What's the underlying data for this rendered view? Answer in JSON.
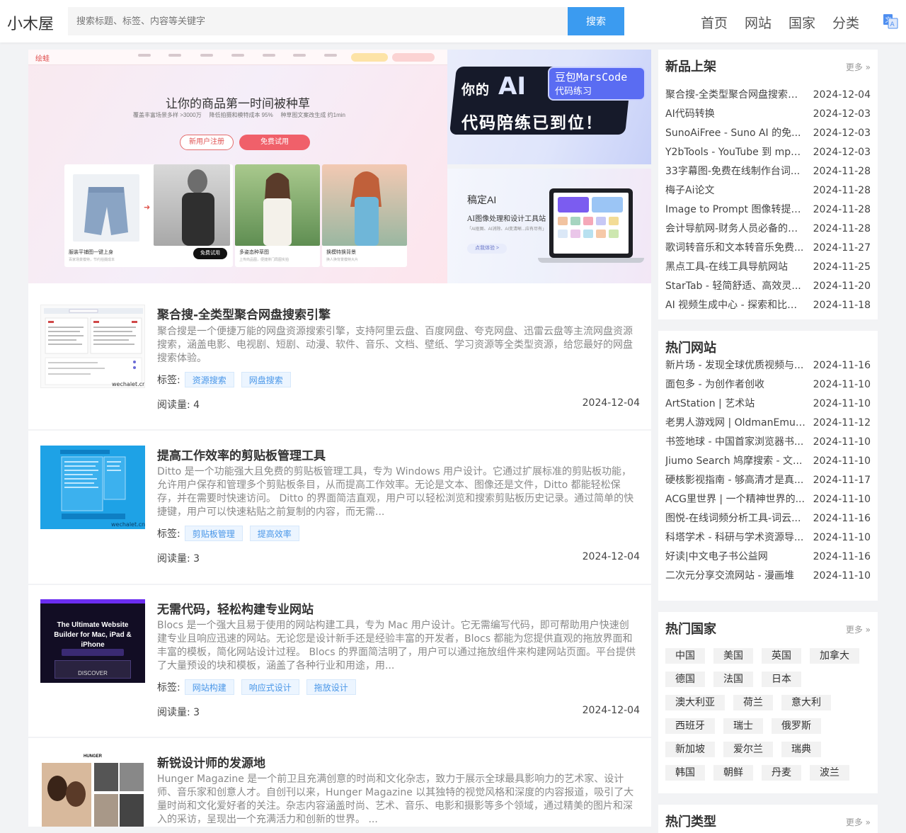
{
  "header": {
    "logo": "小木屋",
    "search_placeholder": "搜索标题、标签、内容等关键字",
    "search_button": "搜索",
    "nav": [
      "首页",
      "网站",
      "国家",
      "分类"
    ],
    "lang_icon": "translate-icon"
  },
  "banner": {
    "main": {
      "brand": "绘蛙",
      "title": "让你的商品第一时间被种草",
      "stats": [
        "覆盖丰富场景多样 >3000万",
        "降低拍摄和模特成本 95%",
        "种草图文案改生成 约1min"
      ],
      "register_button": "新用户注册",
      "trial_button": "免费试用",
      "panel1_label": "服装平铺图一键上身",
      "panel1_sub": "百家场景模特，节约拍摄成本",
      "panel1_button": "免费试用",
      "panel2_label": "多姿态种草图",
      "panel2_sub": "上传商品图，便捷排门局图实拍",
      "panel3_label": "换模特换背景",
      "panel3_sub": "换人换背景模特大片"
    },
    "side1": {
      "line1": "你的",
      "ai": "AI",
      "line2": "代码陪练已到位！",
      "blue1": "豆包MarsCode",
      "blue2": "代码练习"
    },
    "side2": {
      "title": "稿定AI",
      "subtitle": "AI图像处理和设计工具站",
      "small": "「AI抠图、AI消除、AI变清晰...应有尽有」",
      "button": "点我体验 >"
    }
  },
  "articles": [
    {
      "title": "聚合搜-全类型聚合网盘搜索引擎",
      "desc": "聚合搜是一个便捷万能的网盘资源搜索引擎，支持阿里云盘、百度网盘、夸克网盘、迅雷云盘等主流网盘资源搜索，涵盖电影、电视剧、短剧、动漫、软件、音乐、文档、壁纸、学习资源等全类型资源，给您最好的网盘搜索体验。",
      "tag_label": "标签:",
      "tags": [
        "资源搜索",
        "网盘搜索"
      ],
      "reads": "阅读量: 4",
      "date": "2024-12-04",
      "thumb_watermark": "wechalet.cn"
    },
    {
      "title": "提高工作效率的剪贴板管理工具",
      "desc": "Ditto 是一个功能强大且免费的剪贴板管理工具，专为 Windows 用户设计。它通过扩展标准的剪贴板功能，允许用户保存和管理多个剪贴板条目，从而提高工作效率。无论是文本、图像还是文件，Ditto 都能轻松保存，并在需要时快速访问。 Ditto 的界面简洁直观，用户可以轻松浏览和搜索剪贴板历史记录。通过简单的快捷键，用户可以快速粘贴之前复制的内容，而无需...",
      "tag_label": "标签:",
      "tags": [
        "剪贴板管理",
        "提高效率"
      ],
      "reads": "阅读量: 3",
      "date": "2024-12-04",
      "thumb_watermark": "wechalet.cn"
    },
    {
      "title": "无需代码，轻松构建专业网站",
      "desc": "Blocs 是一个强大且易于使用的网站构建工具，专为 Mac 用户设计。它无需编写代码，即可帮助用户快速创建专业且响应迅速的网站。无论您是设计新手还是经验丰富的开发者，Blocs 都能为您提供直观的拖放界面和丰富的模板，简化网站设计过程。 Blocs 的界面简洁明了，用户可以通过拖放组件来构建网站页面。平台提供了大量预设的块和模板，涵盖了各种行业和用途，用...",
      "tag_label": "标签:",
      "tags": [
        "网站构建",
        "响应式设计",
        "拖放设计"
      ],
      "reads": "阅读量: 3",
      "date": "2024-12-04",
      "thumb_title": "The Ultimate Website Builder for Mac, iPad & iPhone",
      "thumb_button": "DISCOVER"
    },
    {
      "title": "新锐设计师的发源地",
      "desc": "Hunger Magazine 是一个前卫且充满创意的时尚和文化杂志，致力于展示全球最具影响力的艺术家、设计师、音乐家和创意人才。自创刊以来，Hunger Magazine 以其独特的视觉风格和深度的内容报道，吸引了大量时尚和文化爱好者的关注。杂志内容涵盖时尚、艺术、音乐、电影和摄影等多个领域，通过精美的图片和深入的采访，呈现出一个充满活力和创新的世界。 ...",
      "thumb_title": "HUNGER"
    }
  ],
  "sidebar": {
    "new": {
      "title": "新品上架",
      "more": "更多 »",
      "items": [
        {
          "name": "聚合搜-全类型聚合网盘搜索引...",
          "date": "2024-12-04"
        },
        {
          "name": "AI代码转换",
          "date": "2024-12-03"
        },
        {
          "name": "SunoAiFree - Suno AI 的免...",
          "date": "2024-12-03"
        },
        {
          "name": "Y2bTools - YouTube 到 mp3...",
          "date": "2024-12-03"
        },
        {
          "name": "33字幕图-免费在线制作台词...",
          "date": "2024-11-28"
        },
        {
          "name": "梅子Ai论文",
          "date": "2024-11-28"
        },
        {
          "name": "Image to Prompt 图像转提示...",
          "date": "2024-11-28"
        },
        {
          "name": "会计导航网-财务人员必备的会...",
          "date": "2024-11-28"
        },
        {
          "name": "歌词转音乐和文本转音乐免费...",
          "date": "2024-11-27"
        },
        {
          "name": "黑点工具-在线工具导航网站",
          "date": "2024-11-25"
        },
        {
          "name": "StarTab - 轻简舒适、高效灵...",
          "date": "2024-11-20"
        },
        {
          "name": "AI 视频生成中心 - 探索和比较...",
          "date": "2024-11-18"
        }
      ]
    },
    "hot_sites": {
      "title": "热门网站",
      "items": [
        {
          "name": "新片场 - 发现全球优质视频与...",
          "date": "2024-11-16"
        },
        {
          "name": "面包多 - 为创作者创收",
          "date": "2024-11-10"
        },
        {
          "name": "ArtStation | 艺术站",
          "date": "2024-11-10"
        },
        {
          "name": "老男人游戏网 | OldmanEmu....",
          "date": "2024-11-12"
        },
        {
          "name": "书签地球 - 中国首家浏览器书...",
          "date": "2024-11-10"
        },
        {
          "name": "Jiumo Search 鸠摩搜索 - 文...",
          "date": "2024-11-10"
        },
        {
          "name": "硬核影视指南 - 够高清才是真...",
          "date": "2024-11-17"
        },
        {
          "name": "ACG里世界 | 一个精神世界的...",
          "date": "2024-11-10"
        },
        {
          "name": "图悦-在线词频分析工具-词云...",
          "date": "2024-11-16"
        },
        {
          "name": "科塔学术 - 科研与学术资源导...",
          "date": "2024-11-10"
        },
        {
          "name": "好读|中文电子书公益网",
          "date": "2024-11-16"
        },
        {
          "name": "二次元分享交流网站 - 漫画堆",
          "date": "2024-11-10"
        }
      ]
    },
    "hot_countries": {
      "title": "热门国家",
      "more": "更多 »",
      "rows": [
        [
          "中国",
          "美国",
          "英国",
          "加拿大"
        ],
        [
          "德国",
          "法国",
          "日本"
        ],
        [
          "澳大利亚",
          "荷兰",
          "意大利"
        ],
        [
          "西班牙",
          "瑞士",
          "俄罗斯"
        ],
        [
          "新加坡",
          "爱尔兰",
          "瑞典"
        ],
        [
          "韩国",
          "朝鲜",
          "丹麦",
          "波兰"
        ]
      ]
    },
    "hot_types": {
      "title": "热门类型",
      "more": "更多 »"
    }
  }
}
